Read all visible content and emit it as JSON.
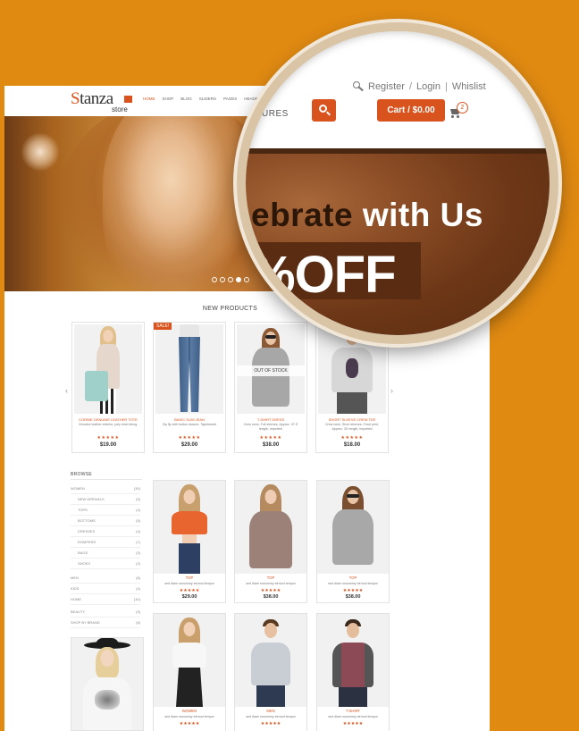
{
  "site": {
    "logo_text": "Stanza",
    "logo_sub": "store",
    "nav": [
      "HOME",
      "SHOP",
      "BLOG",
      "SLIDERS",
      "PAGES",
      "HEADERS"
    ],
    "account": {
      "register": "Register",
      "login": "Login",
      "wishlist": "Whislist"
    },
    "nav_partial": "URES",
    "cart_label": "Cart / $0.00",
    "cart_count": "2"
  },
  "hero": {
    "headline_partial": "ebrate with Us",
    "offer_partial": "%OFF",
    "dots": 5,
    "active_dot": 4
  },
  "new_products": {
    "title": "NEW PRODUCTS",
    "items": [
      {
        "name": "CORINE GENUINE LEATHER TOTE",
        "desc": "Genuine leather exterior, poly resin lining.",
        "price": "$19.00"
      },
      {
        "name": "BASIC SLIM JEAN",
        "desc": "Zip fly with button closure, Tapestored",
        "price": "$29.00",
        "badge": "SALE!"
      },
      {
        "name": "T-SHIRT DRESS",
        "desc": "Crew neck, Full sleeves, Approx. 37.5' length, Imported",
        "price": "$38.00",
        "badge": "OUT OF STOCK"
      },
      {
        "name": "SHORT SLEEVE CREW TEE",
        "desc": "Crew neck, Short sleeves, Front print, Approx. 30' length, Imported",
        "price": "$18.00"
      }
    ]
  },
  "browse": {
    "title": "BROWSE",
    "categories": [
      {
        "label": "WOMEN",
        "count": "(30)"
      },
      {
        "label": "NEW ARRIVALS",
        "count": "(5)"
      },
      {
        "label": "TOPS",
        "count": "(4)"
      },
      {
        "label": "BOTTOMS",
        "count": "(5)"
      },
      {
        "label": "DRESSES",
        "count": "(4)"
      },
      {
        "label": "ROMPERS",
        "count": "(7)"
      },
      {
        "label": "BAGS",
        "count": "(3)"
      },
      {
        "label": "SHOES",
        "count": "(2)"
      },
      {
        "label": "MEN",
        "count": "(8)"
      },
      {
        "label": "KIDS",
        "count": "(4)"
      },
      {
        "label": "HOME",
        "count": "(10)"
      },
      {
        "label": "BEAUTY",
        "count": "(9)"
      },
      {
        "label": "SHOP BY BRAND",
        "count": "(6)"
      }
    ]
  },
  "grid": {
    "desc": "sed diam nonummy eirmod tempor",
    "items": [
      {
        "name": "TOP",
        "price": "$29.00"
      },
      {
        "name": "TOP",
        "price": "$38.00"
      },
      {
        "name": "TOP",
        "price": "$38.00"
      },
      {
        "name": "WOMEN",
        "price": ""
      },
      {
        "name": "MEN",
        "price": ""
      },
      {
        "name": "T-SHIRT",
        "price": ""
      }
    ]
  },
  "colors": {
    "accent": "#d9531e",
    "background": "#e08a12"
  }
}
